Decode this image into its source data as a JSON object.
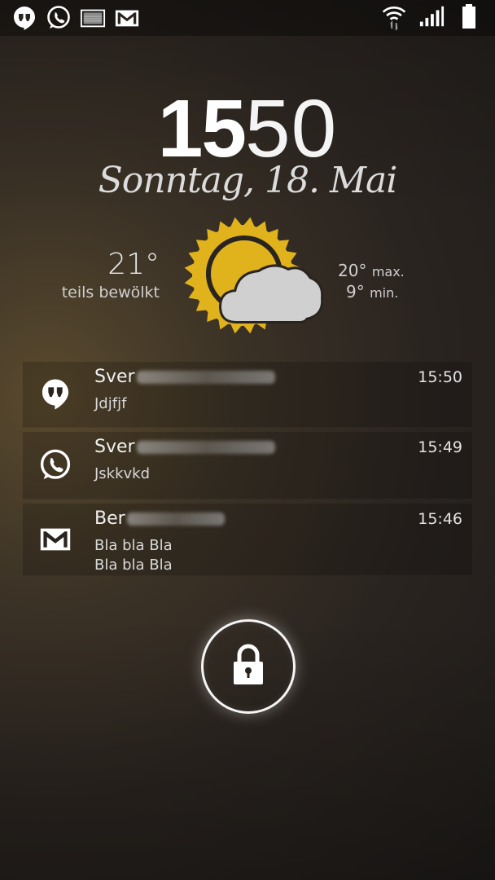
{
  "status_bar": {
    "left_icons": [
      "hangouts-icon",
      "whatsapp-icon",
      "image-notification-icon",
      "gmail-icon"
    ],
    "right_icons": [
      "wifi-icon",
      "signal-icon",
      "battery-icon"
    ]
  },
  "clock": {
    "hours": "15",
    "minutes": "50"
  },
  "date": "Sonntag, 18. Mai",
  "weather": {
    "current_temp": "21°",
    "condition": "teils bewölkt",
    "max_temp": "20°",
    "max_label": "max.",
    "min_temp": "9°",
    "min_label": "min.",
    "icon": "partly-cloudy-icon",
    "sun_color": "#e0b21c"
  },
  "notifications": [
    {
      "app_icon": "hangouts-icon",
      "title": "Sver",
      "text": "Jdjfjf",
      "time": "15:50"
    },
    {
      "app_icon": "whatsapp-icon",
      "title": "Sver",
      "text": "Jskkvkd",
      "time": "15:49"
    },
    {
      "app_icon": "gmail-icon",
      "title": "Ber",
      "text_line1": "Bla bla Bla",
      "text_line2": "Bla bla Bla",
      "time": "15:46"
    }
  ],
  "lock": {
    "icon": "padlock-icon"
  }
}
